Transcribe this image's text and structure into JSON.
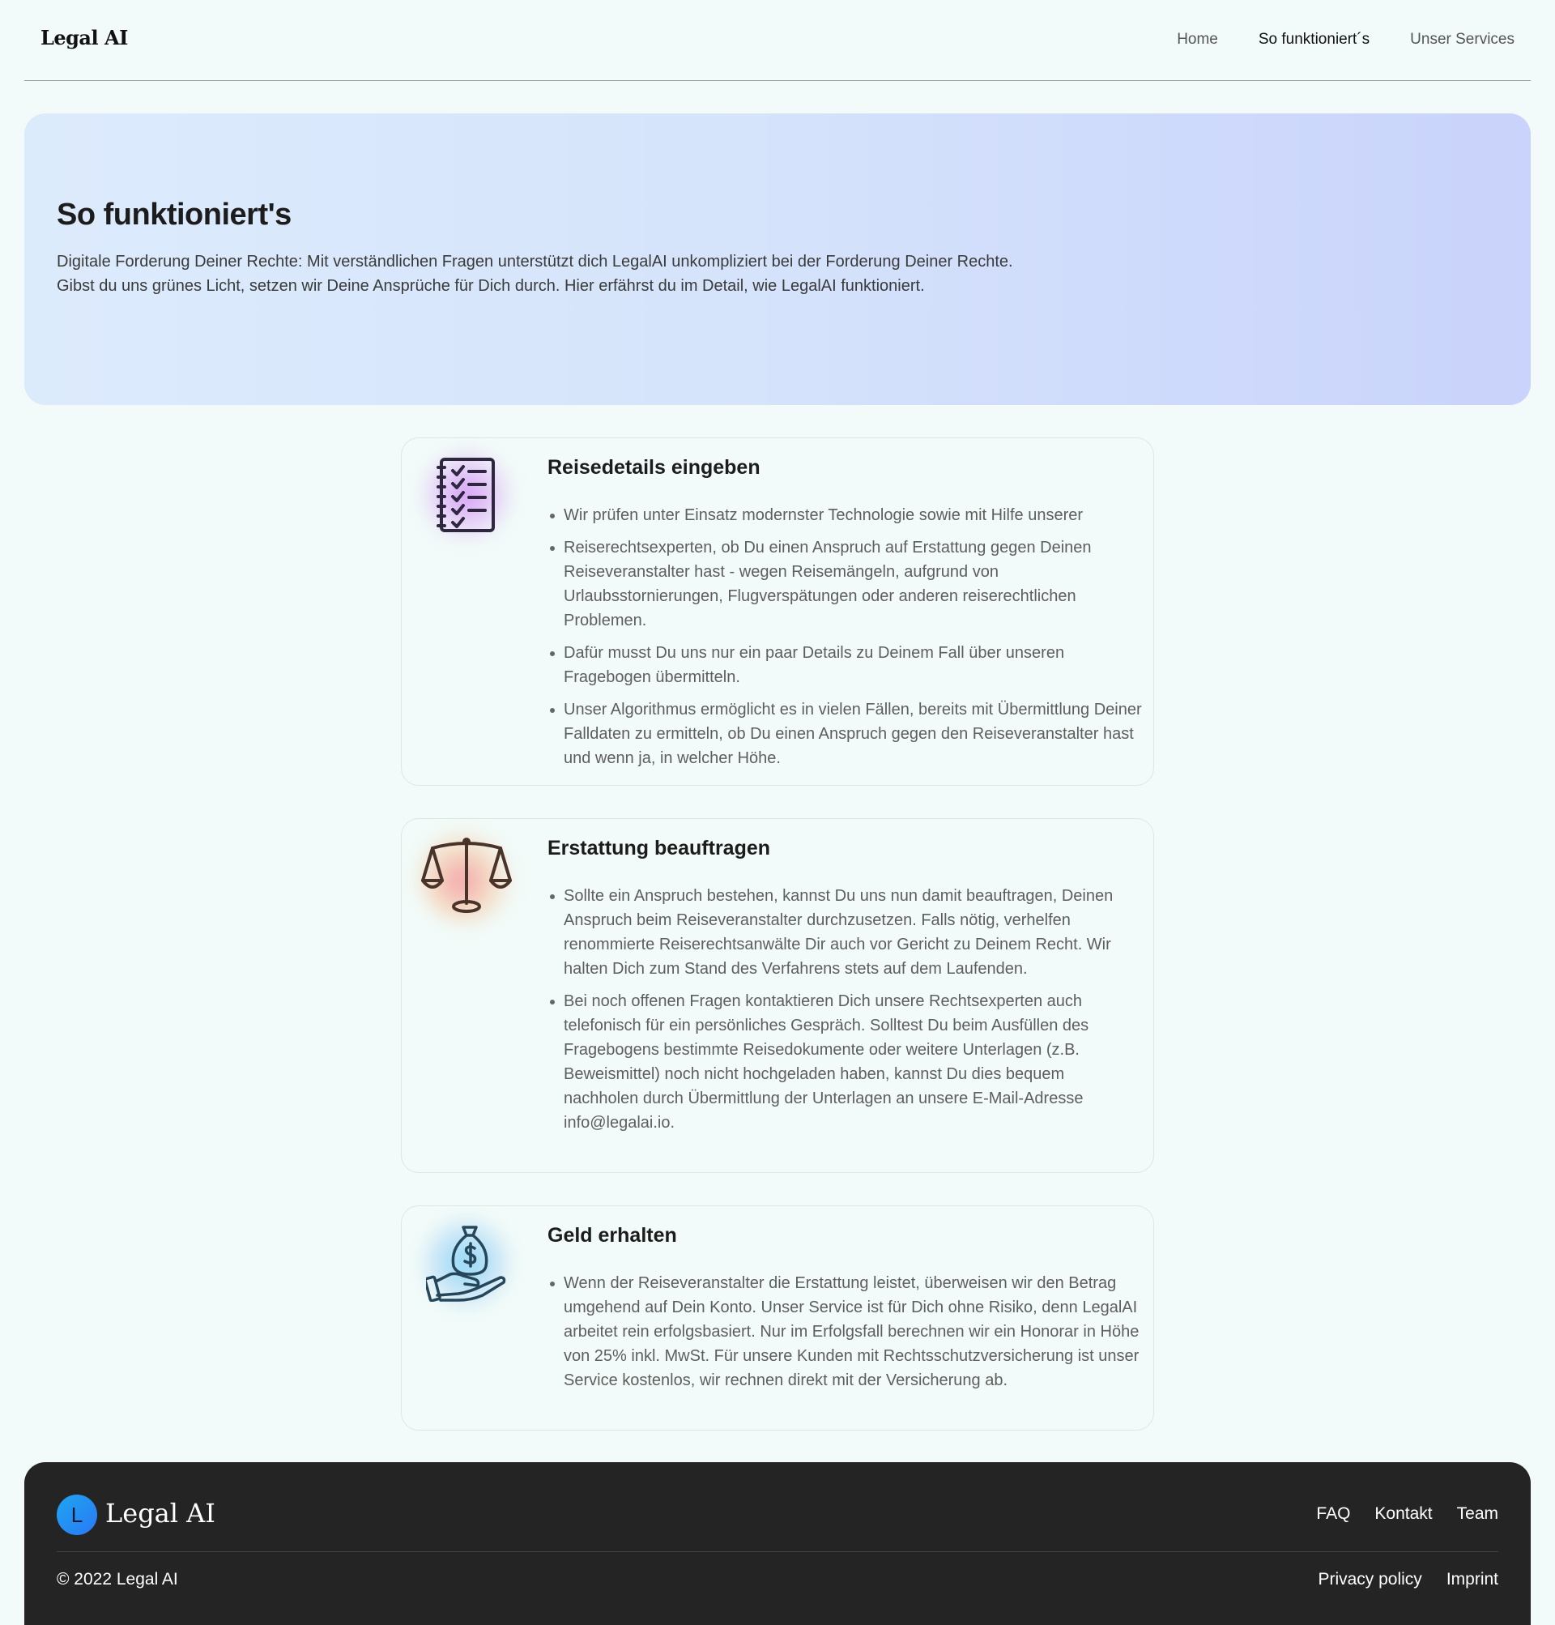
{
  "header": {
    "logo": "Legal AI",
    "nav": [
      {
        "label": "Home"
      },
      {
        "label": "So funktioniert´s"
      },
      {
        "label": "Unser Services"
      }
    ]
  },
  "hero": {
    "title": "So funktioniert's",
    "text": "Digitale Forderung Deiner Rechte: Mit verständlichen Fragen unterstützt dich LegalAI unkompliziert bei der Forderung Deiner Rechte. Gibst du uns grünes Licht, setzen wir Deine Ansprüche für Dich durch. Hier erfährst du im Detail, wie LegalAI funktioniert."
  },
  "steps": [
    {
      "icon": "checklist-icon",
      "title": "Reisedetails eingeben",
      "items": [
        "Wir prüfen unter Einsatz modernster Technologie sowie mit Hilfe unserer",
        "Reiserechtsexperten, ob Du einen Anspruch auf Erstattung gegen Deinen Reiseveranstalter hast - wegen Reisemängeln, aufgrund von Urlaubsstornierungen, Flugverspätungen oder anderen reiserechtlichen Problemen.",
        "Dafür musst Du uns nur ein paar Details zu Deinem Fall über unseren Fragebogen übermitteln.",
        "Unser Algorithmus ermöglicht es in vielen Fällen, bereits mit Übermittlung Deiner Falldaten zu ermitteln, ob Du einen Anspruch gegen den Reiseveranstalter hast und wenn ja, in welcher Höhe."
      ]
    },
    {
      "icon": "scales-icon",
      "title": "Erstattung beauftragen",
      "items": [
        "Sollte ein Anspruch bestehen, kannst Du uns nun damit beauftragen, Deinen Anspruch beim Reiseveranstalter durchzusetzen. Falls nötig, verhelfen renommierte Reiserechtsanwälte Dir auch vor Gericht zu Deinem Recht. Wir halten Dich zum Stand des Verfahrens stets auf dem Laufenden.",
        "Bei noch offenen Fragen kontaktieren Dich unsere Rechtsexperten auch telefonisch für ein persönliches Gespräch. Solltest Du beim Ausfüllen des Fragebogens bestimmte Reisedokumente oder weitere Unterlagen (z.B. Beweismittel) noch nicht hochgeladen haben, kannst Du dies bequem nachholen durch Übermittlung der Unterlagen an unsere E-Mail-Adresse info@legalai.io."
      ]
    },
    {
      "icon": "money-bag-hand-icon",
      "title": "Geld erhalten",
      "items": [
        "Wenn der Reiseveranstalter die Erstattung leistet, überweisen wir den Betrag umgehend auf Dein Konto. Unser Service ist für Dich ohne Risiko, denn LegalAI arbeitet rein erfolgsbasiert. Nur im Erfolgsfall berechnen wir ein Honorar in Höhe von 25% inkl. MwSt. Für unsere Kunden mit Rechtsschutzversicherung ist unser Service kostenlos, wir rechnen direkt mit der Versicherung ab."
      ]
    }
  ],
  "footer": {
    "logo_letter": "L",
    "logo_text": "Legal AI",
    "links": [
      "FAQ",
      "Kontakt",
      "Team"
    ],
    "copyright": "© 2022 Legal AI",
    "legal_links": [
      "Privacy policy",
      "Imprint"
    ]
  },
  "colors": {
    "background": "#f2fbf9",
    "footer_bg": "#242424",
    "hero_gradient_start": "#dcebfc",
    "hero_gradient_end": "#c9d3fb",
    "glow_1": "#d59cf5",
    "glow_2": "#f5a2a8",
    "glow_3": "#8fd9f5"
  }
}
